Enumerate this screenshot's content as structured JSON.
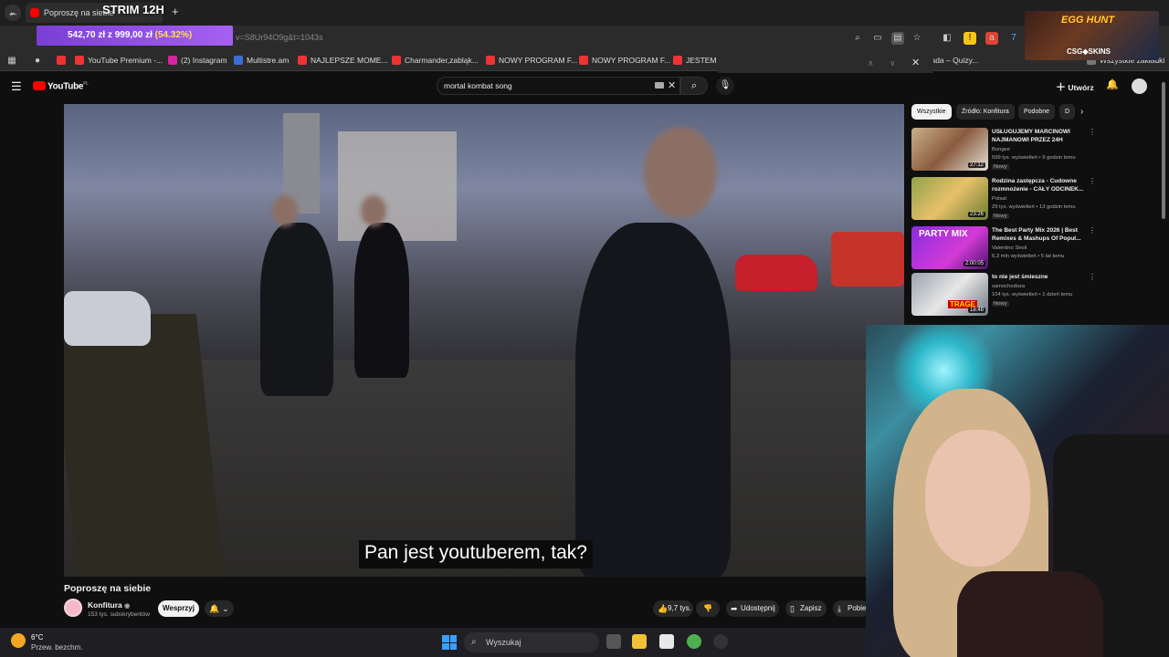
{
  "browser": {
    "active_tab_title": "Poproszę na siebie",
    "stream_title": "STRIM 12H",
    "new_tab": "+",
    "promo_amount": "542,70 zł z 999,00 zł",
    "promo_percent": "(54.32%)",
    "url_fragment": "v=S8Ur94O9g&t=1043s",
    "bookmarks": [
      "YouTube Premium -...",
      "(2) Instagram",
      "Multistre.am",
      "NAJLEPSZE MOME...",
      "Charmander,zabląk...",
      "NOWY PROGRAM F...",
      "NOWY PROGRAM F...",
      "JESTEM D..."
    ],
    "bookmark_extra": "...ialiada – Quizy...",
    "all_bookmarks": "Wszystkie zakładki"
  },
  "overlay": {
    "promo_title": "EGG HUNT",
    "promo_brand": "CSG◆SKINS"
  },
  "youtube": {
    "logo_text": "YouTube",
    "logo_region": "PL",
    "search_value": "mortal kombat song",
    "create_label": "Utwórz",
    "video": {
      "subtitle": "Pan jest youtuberem, tak?",
      "title": "Poproszę na siebie",
      "channel": "Konfitura",
      "subscribers": "153 tys. subskrybentów",
      "subscribe_label": "Wesprzyj",
      "likes": "9,7 tys.",
      "share_label": "Udostępnij",
      "save_label": "Zapisz",
      "download_label": "Pobie"
    },
    "chips": [
      "Wszystkie",
      "Źródło: Konfitura",
      "Podobne",
      "D"
    ],
    "recommendations": [
      {
        "title": "USŁUGUJEMY MARCINOWI NAJMANOWI PRZEZ 24H",
        "channel": "Bungee",
        "meta": "599 tys. wyświetleń • 9 godzin temu",
        "badge": "Nowy",
        "duration": "27:12"
      },
      {
        "title": "Rodzina zastępcza - Cudowne rozmnożenie - CAŁY ODCINEK...",
        "channel": "Polsat",
        "meta": "29 tys. wyświetleń • 13 godzin temu",
        "badge": "Nowy",
        "duration": "23:26"
      },
      {
        "title": "The Best Party Mix 2026 | Best Remixes & Mashups Of Popul...",
        "channel": "Valentino Siroli",
        "meta": "6,3 mln wyświetleń • 5 lat temu",
        "badge": "",
        "duration": "2:00:05",
        "thumb_text": "PARTY MIX"
      },
      {
        "title": "to nie jest śmieszne",
        "channel": "samochodoza",
        "meta": "104 tys. wyświetleń • 1 dzień temu",
        "badge": "Nowy",
        "duration": "18:48",
        "thumb_text": "TRAGE"
      }
    ]
  },
  "taskbar": {
    "temp": "6°C",
    "weather": "Przew. bezchm.",
    "search_label": "Wyszukaj"
  }
}
